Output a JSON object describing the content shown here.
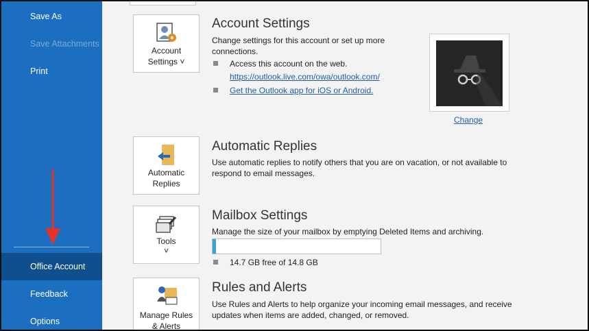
{
  "sidebar": {
    "items": [
      {
        "label": "Save As"
      },
      {
        "label": "Save Attachments"
      },
      {
        "label": "Print"
      },
      {
        "label": "Office Account"
      },
      {
        "label": "Feedback"
      },
      {
        "label": "Options"
      }
    ],
    "arrow_color": "#e8312a"
  },
  "account": {
    "button_line1": "Account",
    "button_line2": "Settings ˅",
    "title": "Account Settings",
    "desc_line1": "Change settings for this account or set up more",
    "desc_line2": "connections.",
    "bullet1": "Access this account on the web.",
    "web_link": "https://outlook.live.com/owa/outlook.com/",
    "app_link": "Get the Outlook app for iOS or Android.",
    "change_label": "Change"
  },
  "auto_replies": {
    "button_line1": "Automatic",
    "button_line2": "Replies",
    "title": "Automatic Replies",
    "desc_line1": "Use automatic replies to notify others that you are on vacation, or not available to",
    "desc_line2": "respond to email messages."
  },
  "mailbox": {
    "button_line1": "Tools",
    "button_line2": "˅",
    "title": "Mailbox Settings",
    "desc": "Manage the size of your mailbox by emptying Deleted Items and archiving.",
    "usage_fraction": 0.007,
    "usage_text": "14.7 GB free of 14.8 GB"
  },
  "rules": {
    "button_line1": "Manage Rules",
    "button_line2": "& Alerts",
    "title": "Rules and Alerts",
    "desc_line1": "Use Rules and Alerts to help organize your incoming email messages, and receive",
    "desc_line2": "updates when items are added, changed, or removed."
  }
}
